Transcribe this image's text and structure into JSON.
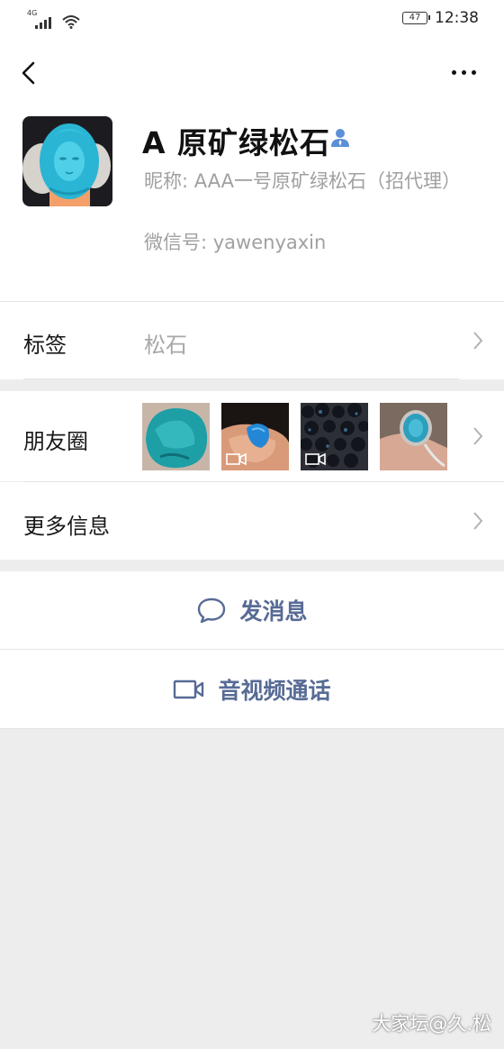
{
  "status_bar": {
    "network": "4G",
    "battery": "47",
    "time": "12:38"
  },
  "profile": {
    "name": "A 原矿绿松石",
    "nickname": "昵称: AAA一号原矿绿松石（招代理）",
    "wechat_id": "微信号: yawenyaxin"
  },
  "rows": {
    "tags_label": "标签",
    "tags_value": "松石",
    "moments_label": "朋友圈",
    "more_info_label": "更多信息"
  },
  "actions": {
    "send_message": "发消息",
    "video_call": "音视频通话"
  },
  "watermark": "大家坛@久.松",
  "colors": {
    "link": "#576b95",
    "muted": "#a0a0a0",
    "background": "#ededed"
  }
}
